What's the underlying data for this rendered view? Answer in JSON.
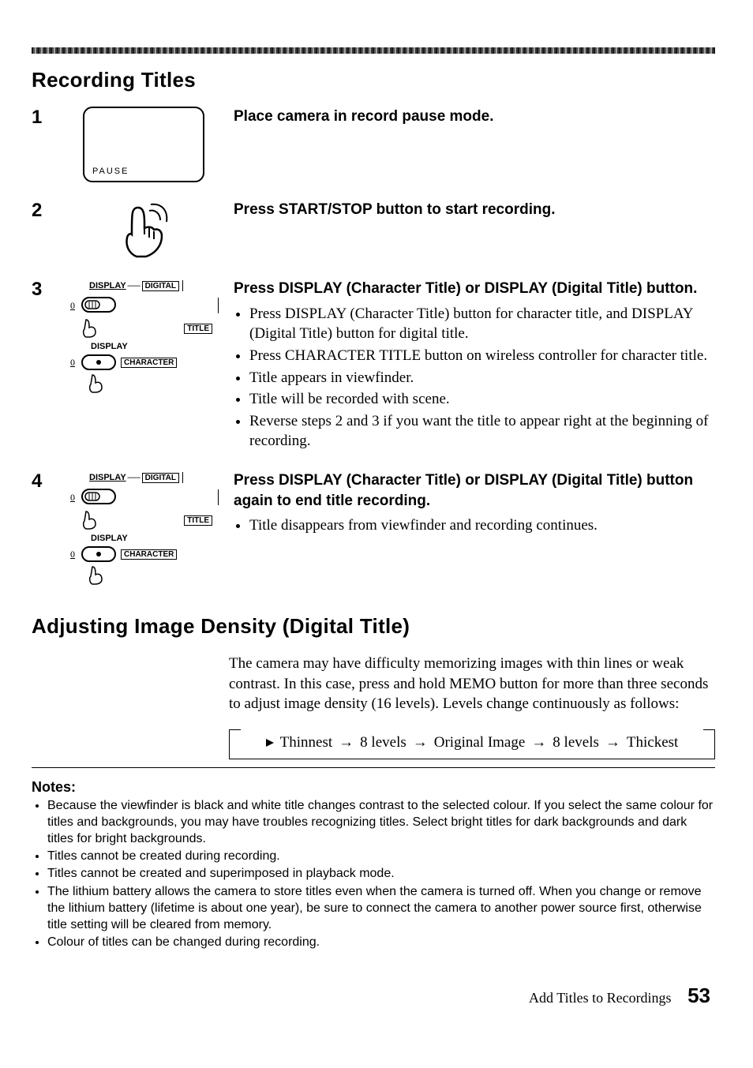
{
  "section1_title": "Recording Titles",
  "steps": [
    {
      "num": "1",
      "heading": "Place camera in record pause mode.",
      "viewfinder_label": "PAUSE"
    },
    {
      "num": "2",
      "heading": "Press START/STOP button to start recording."
    },
    {
      "num": "3",
      "heading": "Press DISPLAY (Character Title) or DISPLAY (Digital Title) button.",
      "bullets": [
        "Press DISPLAY (Character Title) button for character title, and DISPLAY (Digital Title) button for digital title.",
        "Press CHARACTER TITLE button on wireless controller for character title.",
        "Title appears in viewfinder.",
        "Title will be recorded with scene.",
        "Reverse steps 2 and 3 if you want the title to appear right at the beginning of recording."
      ],
      "fig": {
        "display": "DISPLAY",
        "digital": "DIGITAL",
        "title": "TITLE",
        "character": "CHARACTER",
        "zero": "0"
      }
    },
    {
      "num": "4",
      "heading": "Press DISPLAY (Character Title) or DISPLAY (Digital Title) button again to end title recording.",
      "bullets": [
        "Title disappears from viewfinder and recording continues."
      ],
      "fig": {
        "display": "DISPLAY",
        "digital": "DIGITAL",
        "title": "TITLE",
        "character": "CHARACTER",
        "zero": "0"
      }
    }
  ],
  "section2_title": "Adjusting Image Density (Digital Title)",
  "density_para": "The camera may have difficulty memorizing images with thin lines or weak contrast. In this case, press and hold MEMO button for more than three seconds to adjust image density (16 levels). Levels change continuously as follows:",
  "density_flow": {
    "thinnest": "Thinnest",
    "levels8a": "8 levels",
    "original": "Original Image",
    "levels8b": "8 levels",
    "thickest": "Thickest",
    "arrow": "→"
  },
  "notes_heading": "Notes:",
  "notes": [
    "Because the viewfinder is black and white title changes contrast to the selected colour. If you select the same colour for titles and backgrounds, you may have troubles recognizing titles. Select bright titles for dark backgrounds and dark titles for bright backgrounds.",
    "Titles cannot be created during recording.",
    "Titles cannot be created and superimposed in playback mode.",
    "The lithium battery allows the camera to store titles even when the camera is turned off. When you change or remove the lithium battery (lifetime is about one year), be sure to connect the camera to another power source first, otherwise title setting will be cleared from memory.",
    "Colour of titles can be changed during recording."
  ],
  "footer": {
    "text": "Add Titles to Recordings",
    "page": "53"
  }
}
